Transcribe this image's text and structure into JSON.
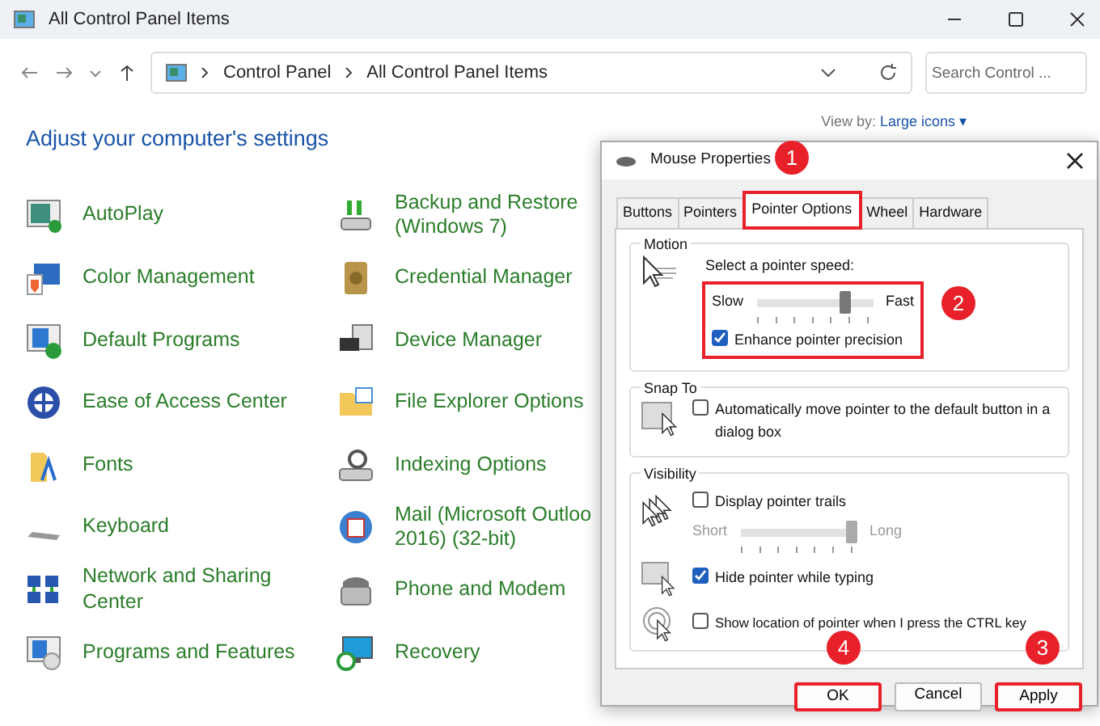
{
  "window": {
    "title": "All Control Panel Items"
  },
  "address_bar": {
    "breadcrumbs": [
      "Control Panel",
      "All Control Panel Items"
    ]
  },
  "search": {
    "placeholder": "Search Control ..."
  },
  "heading": "Adjust your computer's settings",
  "view_by": {
    "label": "View by:",
    "value": "Large icons ▾"
  },
  "items": [
    {
      "label": "AutoPlay"
    },
    {
      "label": "Backup and Restore\n(Windows 7)"
    },
    {
      "label": "Color Management"
    },
    {
      "label": "Credential Manager"
    },
    {
      "label": "Default Programs"
    },
    {
      "label": "Device Manager"
    },
    {
      "label": "Ease of Access Center"
    },
    {
      "label": "File Explorer Options"
    },
    {
      "label": "Fonts"
    },
    {
      "label": "Indexing Options"
    },
    {
      "label": "Keyboard"
    },
    {
      "label": "Mail (Microsoft Outloo\n2016) (32-bit)"
    },
    {
      "label": "Network and Sharing\nCenter"
    },
    {
      "label": "Phone and Modem"
    },
    {
      "label": "Programs and Features"
    },
    {
      "label": "Recovery"
    }
  ],
  "dialog": {
    "title": "Mouse Properties",
    "tabs": [
      {
        "label": "Buttons",
        "selected": false,
        "highlighted": false
      },
      {
        "label": "Pointers",
        "selected": false,
        "highlighted": false
      },
      {
        "label": "Pointer Options",
        "selected": true,
        "highlighted": true
      },
      {
        "label": "Wheel",
        "selected": false,
        "highlighted": false
      },
      {
        "label": "Hardware",
        "selected": false,
        "highlighted": false
      }
    ],
    "motion": {
      "title": "Motion",
      "speed_label": "Select a pointer speed:",
      "slow": "Slow",
      "fast": "Fast",
      "level": 0.76,
      "highlighted": true,
      "precision": {
        "label": "Enhance pointer precision",
        "checked": true
      }
    },
    "snap_to": {
      "title": "Snap To",
      "option": {
        "label": "Automatically move pointer to the default button in a dialog box",
        "checked": false
      }
    },
    "visibility": {
      "title": "Visibility",
      "trails": {
        "label": "Display pointer trails",
        "checked": false
      },
      "trail_length": {
        "short": "Short",
        "long": "Long",
        "level": 0.95,
        "disabled": true
      },
      "hide": {
        "label": "Hide pointer while typing",
        "checked": true
      },
      "show_location": {
        "label": "Show location of pointer when I press the CTRL key",
        "checked": false
      }
    },
    "buttons": [
      {
        "label": "OK",
        "highlighted": true
      },
      {
        "label": "Cancel",
        "highlighted": false
      },
      {
        "label": "Apply",
        "highlighted": true
      }
    ]
  },
  "callouts": [
    {
      "text": "1"
    },
    {
      "text": "2"
    },
    {
      "text": "3"
    },
    {
      "text": "4"
    }
  ]
}
